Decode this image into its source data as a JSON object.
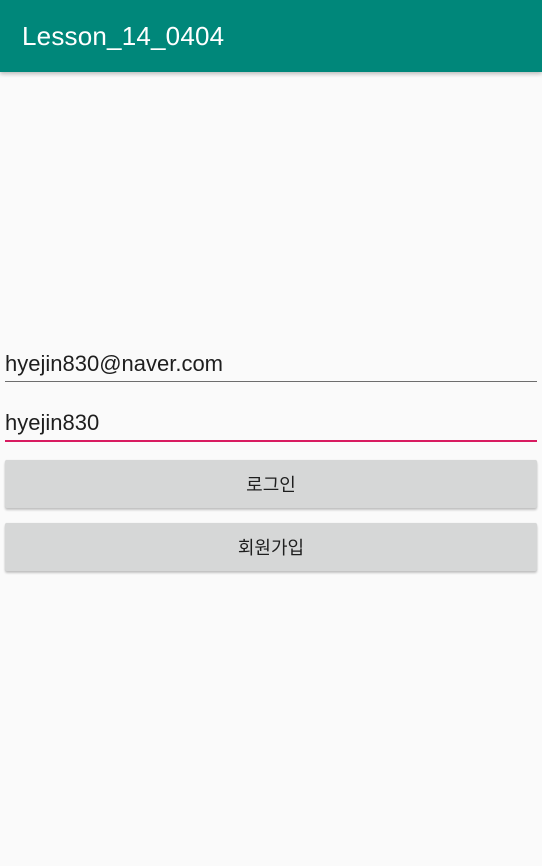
{
  "app_bar": {
    "title": "Lesson_14_0404",
    "color": "#00877a"
  },
  "form": {
    "email_value": "hyejin830@naver.com",
    "password_value": "hyejin830",
    "focused_field_color": "#d81b60",
    "login_label": "로그인",
    "signup_label": "회원가입"
  }
}
